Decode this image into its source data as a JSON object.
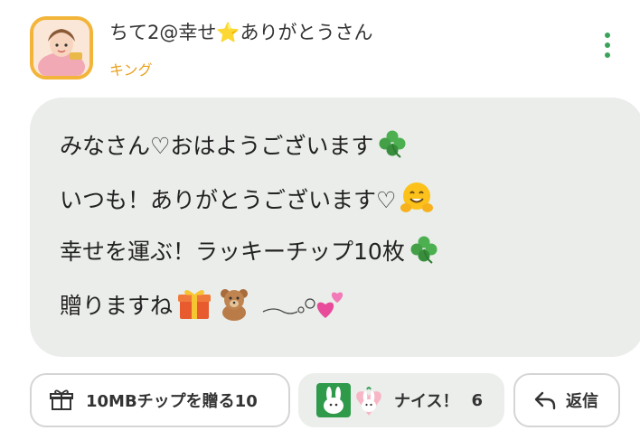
{
  "post": {
    "username": "ちて2@幸せ⭐ありがとうさん",
    "rank": "キング",
    "lines": [
      "みなさん♡おはようございます",
      "いつも！ありがとうございます♡",
      "幸せを運ぶ！ラッキーチップ10枚",
      "贈りますね"
    ],
    "icons": [
      "clover-icon",
      "hugging-face-icon",
      "clover-icon",
      "gift-icon",
      "teddy-bear-icon",
      "swirl-icon",
      "hearts-icon",
      "more-vertical-icon",
      "gift-outline-icon",
      "nice-rabbit-icon",
      "reply-icon"
    ]
  },
  "actions": {
    "gift_label": "10MBチップを贈る10",
    "nice_label": "ナイス！",
    "nice_count": "6",
    "reply_label": "返信"
  },
  "colors": {
    "accent_green": "#3aa35b",
    "rank_orange": "#e8a220",
    "bubble_bg": "#eaede9",
    "avatar_border": "#f2b53a"
  }
}
